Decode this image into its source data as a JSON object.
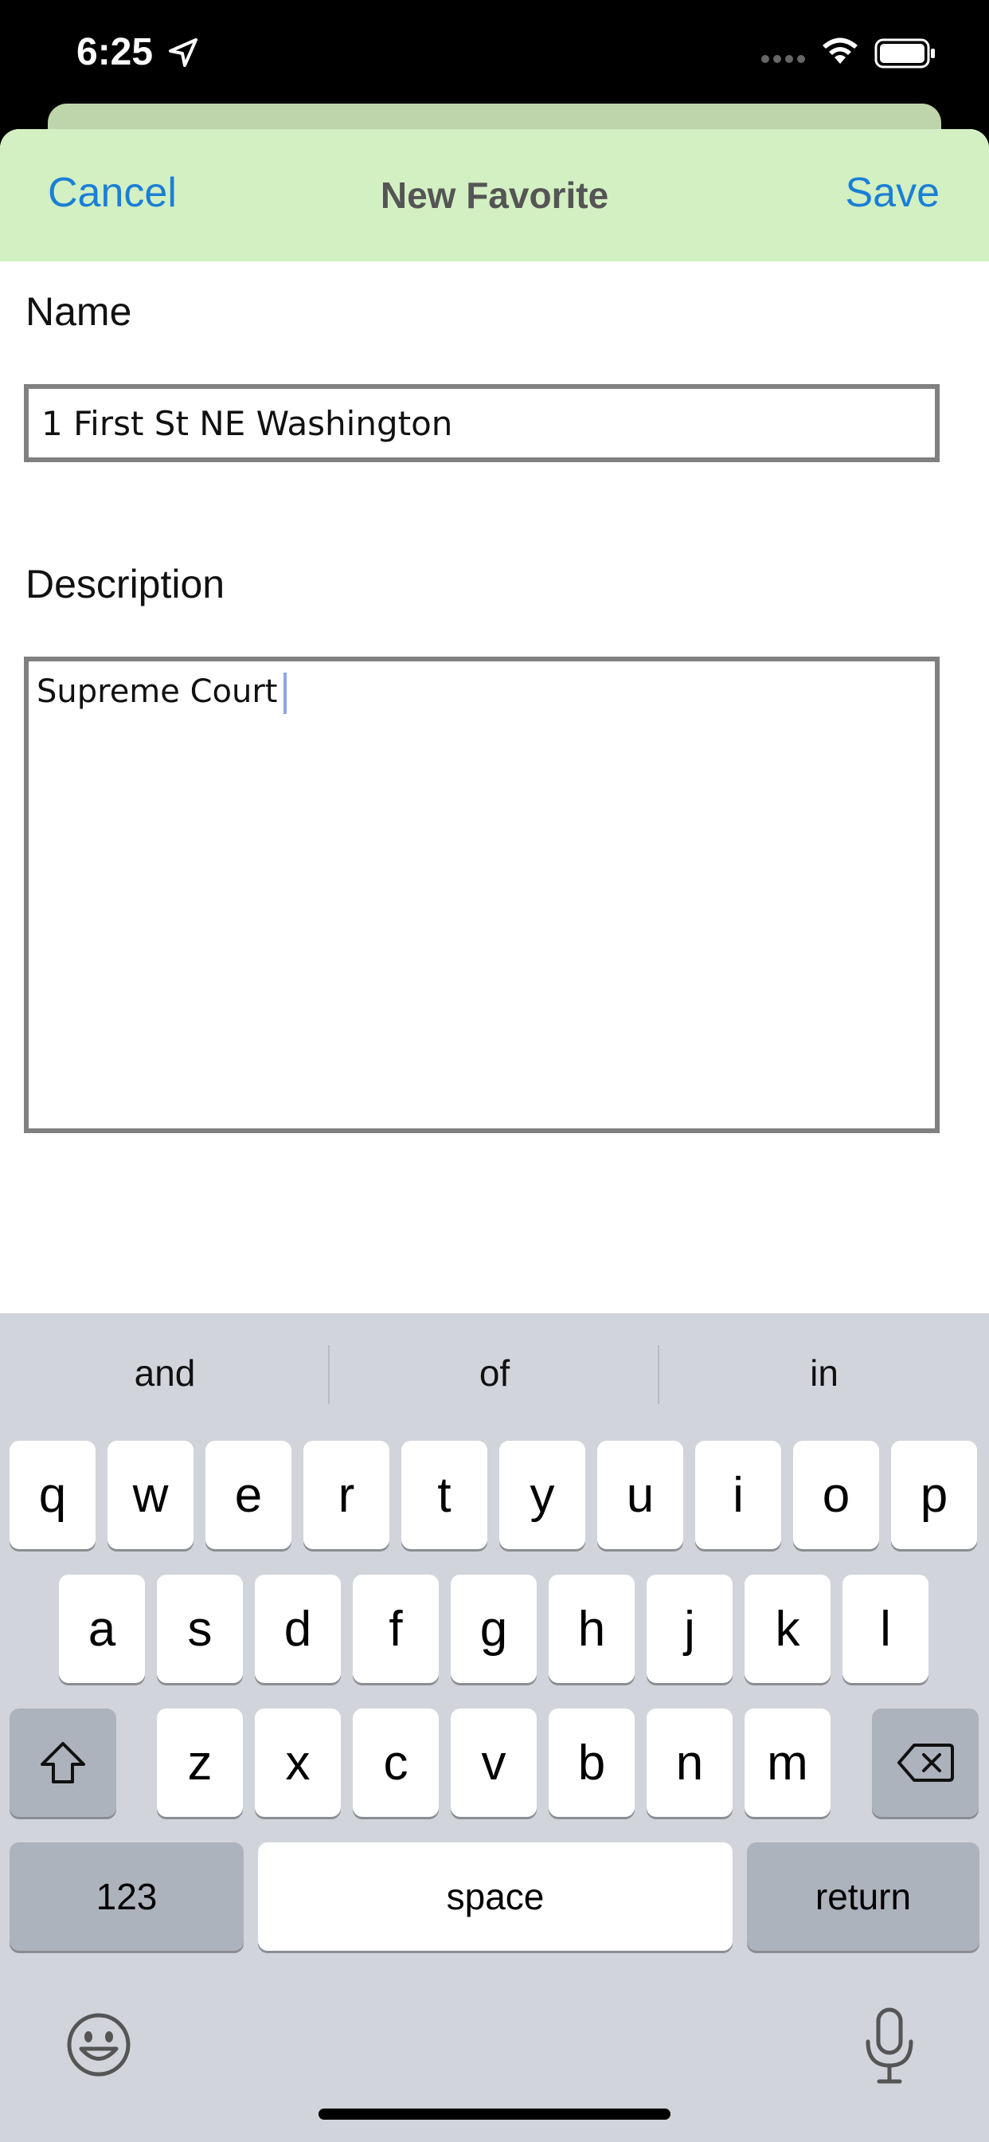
{
  "status_bar": {
    "time": "6:25",
    "icons": [
      "location-arrow-icon",
      "cellular-dots-icon",
      "wifi-icon",
      "battery-icon"
    ]
  },
  "nav": {
    "cancel_label": "Cancel",
    "title": "New Favorite",
    "save_label": "Save"
  },
  "form": {
    "name_label": "Name",
    "name_value": "1 First St NE Washington",
    "description_label": "Description",
    "description_value": "Supreme Court"
  },
  "keyboard": {
    "suggestions": [
      "and",
      "of",
      "in"
    ],
    "row1": [
      "q",
      "w",
      "e",
      "r",
      "t",
      "y",
      "u",
      "i",
      "o",
      "p"
    ],
    "row2": [
      "a",
      "s",
      "d",
      "f",
      "g",
      "h",
      "j",
      "k",
      "l"
    ],
    "row3": [
      "z",
      "x",
      "c",
      "v",
      "b",
      "n",
      "m"
    ],
    "numbers_label": "123",
    "space_label": "space",
    "return_label": "return",
    "icons": [
      "shift-icon",
      "backspace-icon",
      "emoji-icon",
      "microphone-icon"
    ]
  },
  "colors": {
    "nav_background": "#d3f0c2",
    "accent": "#1a7fd6"
  }
}
